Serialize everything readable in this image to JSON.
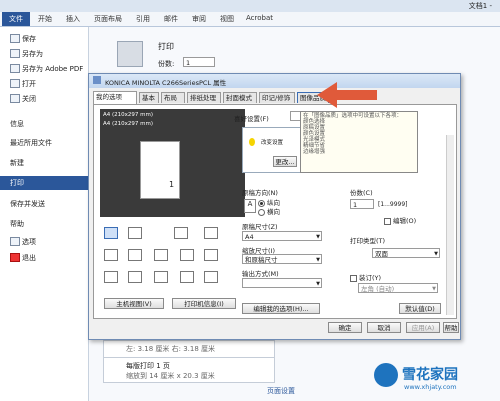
{
  "app": {
    "title": "文档1 -"
  },
  "ribbon_tabs": [
    "开始",
    "插入",
    "页面布局",
    "引用",
    "邮件",
    "审阅",
    "视图",
    "Acrobat"
  ],
  "file_tab": "文件",
  "backstage": {
    "items_small": [
      "保存",
      "另存为",
      "另存为 Adobe PDF",
      "打开",
      "关闭"
    ],
    "items": [
      "信息",
      "最近所用文件",
      "新建",
      "打印",
      "保存并发送",
      "帮助"
    ],
    "items_help": [
      "选项",
      "退出"
    ],
    "selected": "打印"
  },
  "print_panel": {
    "heading": "打印",
    "copies_label": "份数:",
    "copies_value": "1",
    "margins": "左: 3.18 厘米   右: 3.18 厘米",
    "per_page": "每版打印 1 页",
    "per_page_sub": "缩放到 14 厘米 x 20.3 厘米",
    "page_setup": "页面设置"
  },
  "dialog": {
    "title": "KONICA MINOLTA C266SeriesPCL 属性",
    "tabs": [
      "我的选项",
      "基本",
      "布局",
      "排纸处理",
      "封面模式",
      "印记/修饰",
      "图像品质"
    ],
    "paper_size_a": "A4 (210x297 mm)",
    "paper_size_b": "A4 (210x297 mm)",
    "favorites_label": "喜好设置(F)",
    "favorites_value": "",
    "tip_line": "改变设置",
    "tip_btn": "更改...",
    "orientation_label": "原稿方向(N)",
    "orientation_portrait": "纵向",
    "orientation_landscape": "横向",
    "copies_label": "份数(C)",
    "copies_value": "1",
    "copies_range": "[1...9999]",
    "collate": "编辑(O)",
    "paper_size_label": "原稿尺寸(Z)",
    "paper_size_value": "A4",
    "zoom_label": "缩放尺寸(I)",
    "zoom_value": "和原稿尺寸",
    "output_label": "输出方式(M)",
    "output_value": "",
    "print_type_label": "打印类型(T)",
    "print_type_value": "双面",
    "staple": "装订(Y)",
    "staple_value": "左角 (自动)",
    "printer_view_btn": "主机视图(V)",
    "printer_info_btn": "打印机信息(I)",
    "edit_options_btn": "编辑我的选项(H)...",
    "defaults_btn": "默认值(D)",
    "ok_btn": "确定",
    "cancel_btn": "取消",
    "apply_btn": "应用(A)",
    "help_btn": "帮助"
  },
  "tooltip": {
    "title": "在「图像品质」选项中可设置以下各项：",
    "lines": [
      "颜色选择",
      "原稿设置",
      "颜色设置",
      "光泽模式",
      "精细节省",
      "边缘增强"
    ]
  },
  "watermark": {
    "brand": "雪花家园",
    "url": "www.xhjaty.com"
  },
  "colors": {
    "accent": "#2b579a",
    "arrow": "#e05a3a"
  }
}
